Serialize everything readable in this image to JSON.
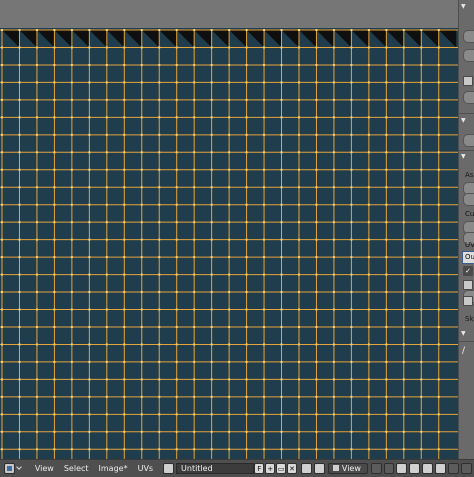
{
  "footer": {
    "menus": [
      "View",
      "Select",
      "Image*",
      "UVs"
    ],
    "image_name": "Untitled",
    "fake_user_label": "F",
    "view_mode": "View"
  },
  "sidebar": {
    "labels": [
      "Asp",
      "Cu",
      "UV",
      "Sk"
    ],
    "uv_field": "Ou"
  },
  "colors": {
    "face_fill": "#1f3d4d",
    "edge": "#e8a33a",
    "vertex": "#ffd27a",
    "background": "#7b7b7b",
    "footer_bg": "#4f4f4f"
  },
  "icons": {
    "editor_type": "image-editor-icon",
    "browse_image": "image-browse-icon",
    "pin": "pin-icon",
    "sync": "uv-sync-icon",
    "pivot": "pivot-icon",
    "snap": "snap-icon"
  }
}
